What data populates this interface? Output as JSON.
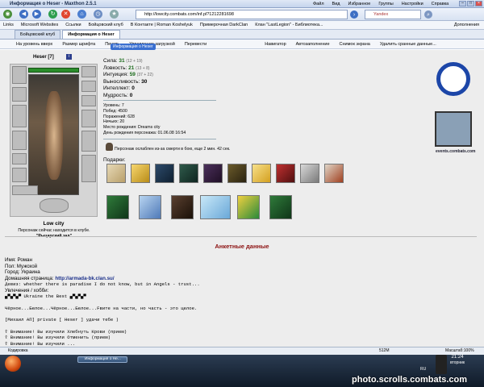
{
  "window": {
    "title": "Информация о Heser - Maxthon 2.5.1",
    "menu": [
      "Файл",
      "Вид",
      "Избранное",
      "Группы",
      "Настройки",
      "Справка"
    ]
  },
  "address": {
    "url": "http://lowcity.combats.com/inf.pl?1212281698",
    "search": "Yandex"
  },
  "linksbar": [
    "Links",
    "Microsoft Websites",
    "Ссылки",
    "Бойцовский клуб",
    "В Контакте | Roman Koshelyuk",
    "Примерочная DarkClan",
    "Клан \"LastLegion\" - Библиотека...",
    "Дополнения"
  ],
  "tabs": [
    "Бойцовский клуб",
    "Информация о Heser"
  ],
  "toolbar2": [
    "На уровень вверх",
    "Размер шрифта",
    "Печать",
    "Управление загрузкой",
    "Перевести",
    "Навигатор",
    "Автозаполнение",
    "Снимок экрана",
    "Удалить сранные данные..."
  ],
  "tooltip": "Информация о Heser",
  "character": {
    "name": "Heser",
    "level": "[7]",
    "badge": "i",
    "location": "Low city",
    "location_sub": "Персонаж сейчас находится в клубе.",
    "location_room": "\"Рыцарский зал\""
  },
  "stats": [
    {
      "label": "Сила:",
      "value": "31",
      "extra": "(12 + 19)"
    },
    {
      "label": "Ловкость:",
      "value": "21",
      "extra": "(13 + 8)"
    },
    {
      "label": "Интуиция:",
      "value": "59",
      "extra": "(37 + 22)"
    },
    {
      "label": "Выносливость:",
      "value": "30",
      "extra": ""
    },
    {
      "label": "Интеллект:",
      "value": "0",
      "extra": ""
    },
    {
      "label": "Мудрость:",
      "value": "0",
      "extra": ""
    }
  ],
  "info": [
    "Уровень: 7",
    "Побед: 4500",
    "Поражений: 628",
    "Ничьих: 20",
    "Место рождения: Dreams city",
    "День рождения персонажа: 01.06.08 16:54"
  ],
  "weak": "Персонаж ослаблен из-за смерти в бою, еще 2 мин. 42 сек.",
  "gifts_label": "Подарки:",
  "sidebar": {
    "site": "events.combats.com"
  },
  "anket_title": "Анкетные данные",
  "profile": {
    "name": "Имя: Роман",
    "sex": "Пол: Мужской",
    "city": "Город: Украина",
    "home_label": "Домашняя страница: ",
    "home_url": "http://armada-bk.clan.su/",
    "motto": "Девиз: whether there is paradise I do not know, but in Angels - trust...",
    "hobby": "Увлечения / хобби:",
    "line1": "▄▀▄▀▄▀ Ukraine the Best ▄▀▄▀▄▀",
    "line2": "Чёрное...Белое...Чёрное...Белое...Fвите на части, но часть - это целое.",
    "line3": "[Михаил АП] private [ Heser ] удачи тебе )",
    "line4": "☦ Внимание! Вы изучили Хлебнуть Крови (прием)",
    "line5": "☦ Внимание! Вы изучили Отменить (прием)",
    "line6": "☦ Внимание! Вы изучили ..."
  },
  "statusbar": {
    "left": "Кодировка",
    "right": "512M",
    "zoom": "Масштаб:100%"
  },
  "taskbar": {
    "item": "Информация о Не...",
    "time": "21:24",
    "day": "вторник",
    "lang": "RU"
  },
  "watermark": "photo.scrolls.combats.com"
}
